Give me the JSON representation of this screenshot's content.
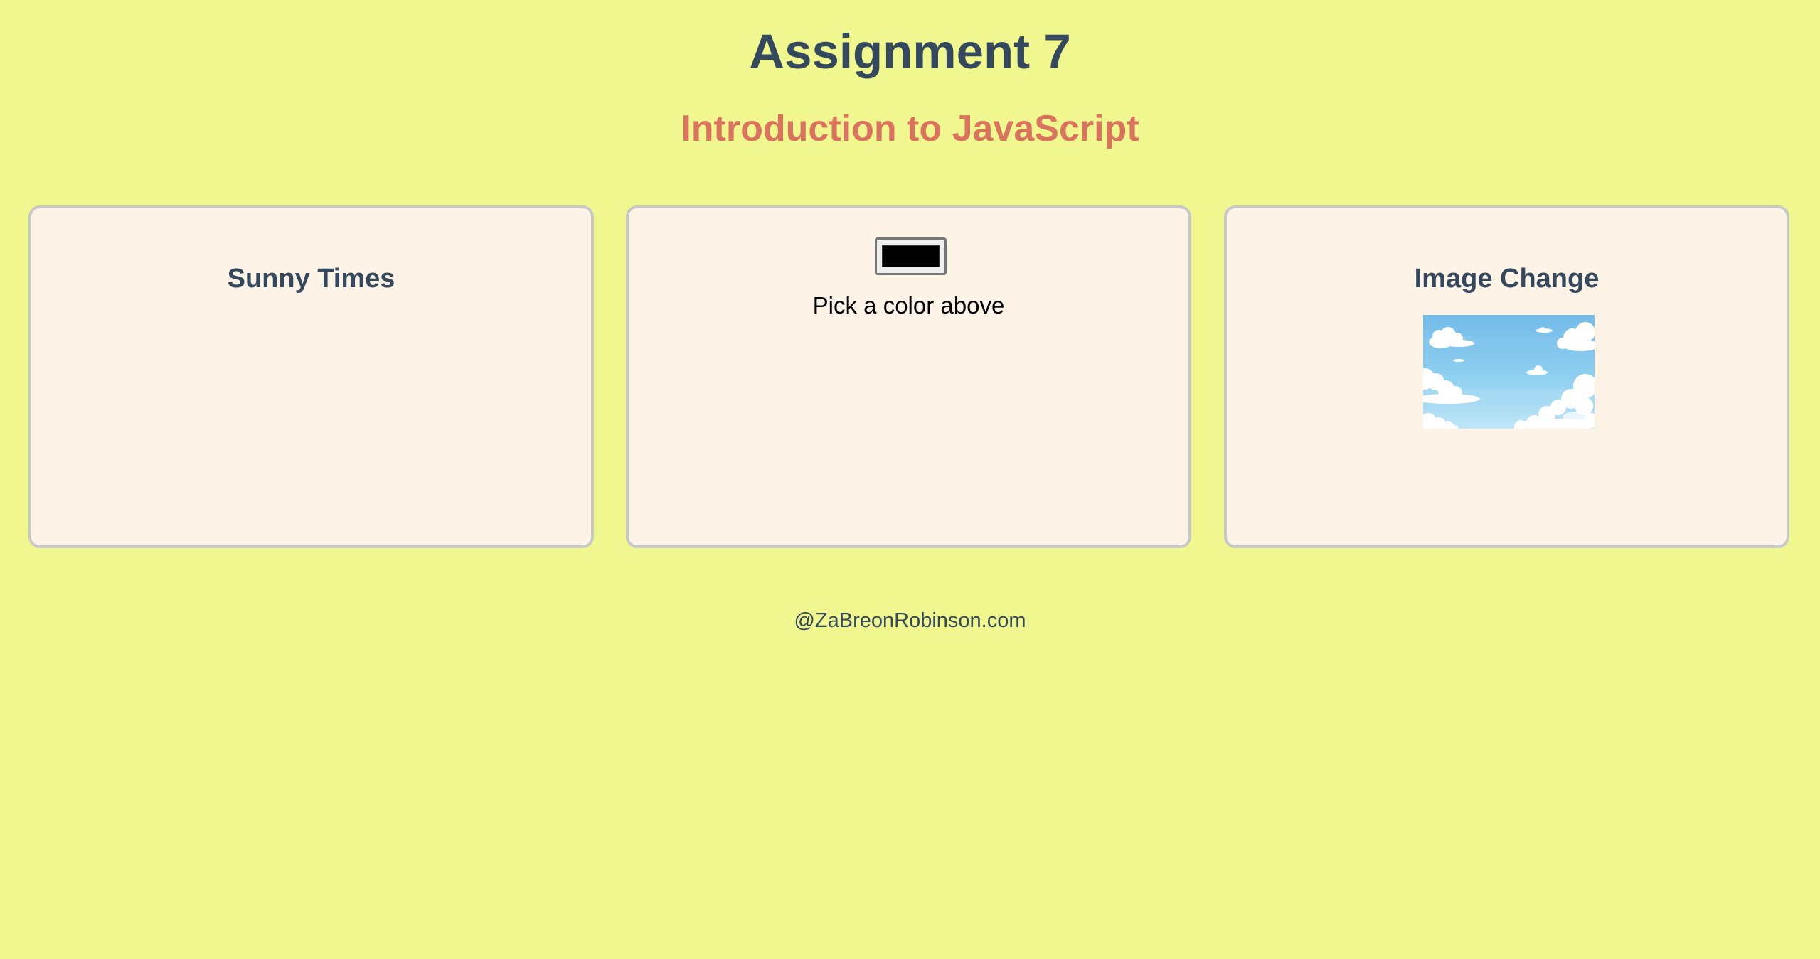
{
  "header": {
    "title": "Assignment 7",
    "subtitle": "Introduction to JavaScript"
  },
  "cards": [
    {
      "heading": "Sunny Times"
    },
    {
      "color_value": "#000000",
      "instruction": "Pick a color above"
    },
    {
      "heading": "Image Change",
      "image_icon": "sky-clouds-image"
    }
  ],
  "footer": {
    "text": "@ZaBreonRobinson.com"
  },
  "colors": {
    "page_background": "#f0f78f",
    "card_background": "#fdf3e7",
    "card_border": "#c8c8c8",
    "title_color": "#34495e",
    "subtitle_color": "#d9735e",
    "picked_color": "#000000"
  }
}
